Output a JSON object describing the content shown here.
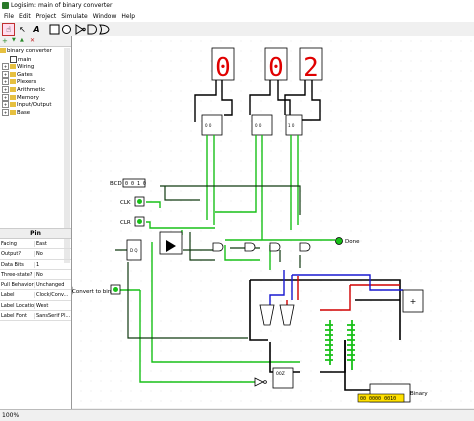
{
  "window": {
    "title": "Logisim: main of binary converter"
  },
  "menu": [
    "File",
    "Edit",
    "Project",
    "Simulate",
    "Window",
    "Help"
  ],
  "toolbar": {
    "poke": "☝",
    "select": "↖",
    "text": "A"
  },
  "toolbar2": {
    "add": "+",
    "down": "▼",
    "up": "▲",
    "del": "✕"
  },
  "tree": {
    "project": "binary converter",
    "items": [
      "main",
      "Wiring",
      "Gates",
      "Plexers",
      "Arithmetic",
      "Memory",
      "Input/Output",
      "Base"
    ]
  },
  "attributes": {
    "header": "Pin",
    "rows": [
      {
        "k": "Facing",
        "v": "East"
      },
      {
        "k": "Output?",
        "v": "No"
      },
      {
        "k": "Data Bits",
        "v": "1"
      },
      {
        "k": "Three-state?",
        "v": "No"
      },
      {
        "k": "Pull Behavior",
        "v": "Unchanged"
      },
      {
        "k": "Label",
        "v": "Clock/Conv..."
      },
      {
        "k": "Label Location",
        "v": "West"
      },
      {
        "k": "Label Font",
        "v": "SansSerif Pl..."
      }
    ]
  },
  "circuit": {
    "digits": [
      "0",
      "0",
      "2"
    ],
    "bcd_label": "BCD",
    "bcd_value": "0 0 1 0",
    "clk_label": "CLK",
    "clr_label": "CLR",
    "done_label": "Done",
    "convert_label": "Convert to binary",
    "binary_label": "Binary",
    "binary_value": "00 0000 0010",
    "adder_label": "+",
    "count_label": "00Z",
    "colors": {
      "on": "#18c018",
      "off": "#103a10",
      "bus": "#000000",
      "red": "#d00000",
      "blue": "#1818d0",
      "seg": "#e00000"
    }
  },
  "status": {
    "zoom": "100%"
  }
}
